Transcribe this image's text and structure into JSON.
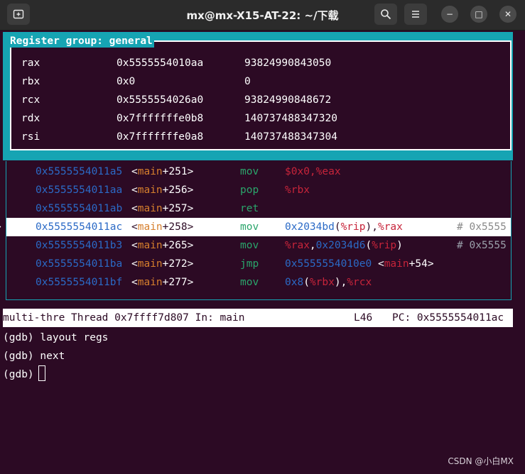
{
  "window": {
    "title": "mx@mx-X15-AT-22: ~/下载",
    "new_tab_icon": "new-tab-icon",
    "search_icon": "search-icon",
    "menu_icon": "hamburger-menu-icon",
    "minimize": "−",
    "maximize": "□",
    "close": "✕"
  },
  "registers": {
    "header": "Register group: general",
    "rows": [
      {
        "name": "rax",
        "hex": "0x5555554010aa",
        "dec": "93824990843050"
      },
      {
        "name": "rbx",
        "hex": "0x0",
        "dec": "0"
      },
      {
        "name": "rcx",
        "hex": "0x5555554026a0",
        "dec": "93824990848672"
      },
      {
        "name": "rdx",
        "hex": "0x7fffffffe0b8",
        "dec": "140737488347320"
      },
      {
        "name": "rsi",
        "hex": "0x7fffffffe0a8",
        "dec": "140737488347304"
      }
    ]
  },
  "asm": {
    "rows": [
      {
        "marker": "",
        "addr": "0x5555554011a5",
        "open": "<",
        "func": "main",
        "offset": "+251",
        "close": ">",
        "mnemonic": "mov",
        "operands": [
          {
            "t": "$0x0",
            "c": "reg"
          },
          {
            "t": ",",
            "c": "reg"
          },
          {
            "t": "%eax",
            "c": "reg"
          }
        ],
        "comment": ""
      },
      {
        "marker": "",
        "addr": "0x5555554011aa",
        "open": "<",
        "func": "main",
        "offset": "+256",
        "close": ">",
        "mnemonic": "pop",
        "operands": [
          {
            "t": "%rbx",
            "c": "reg"
          }
        ],
        "comment": ""
      },
      {
        "marker": "",
        "addr": "0x5555554011ab",
        "open": "<",
        "func": "main",
        "offset": "+257",
        "close": ">",
        "mnemonic": "ret",
        "operands": [],
        "comment": ""
      },
      {
        "marker": ">",
        "addr": "0x5555554011ac",
        "open": "<",
        "func": "main",
        "offset": "+258",
        "close": ">",
        "mnemonic": "mov",
        "operands": [
          {
            "t": "0x2034bd",
            "c": "num"
          },
          {
            "t": "(",
            "c": "paren"
          },
          {
            "t": "%rip",
            "c": "reg"
          },
          {
            "t": "),",
            "c": "paren"
          },
          {
            "t": "%rax",
            "c": "reg"
          }
        ],
        "comment": "# 0x5555"
      },
      {
        "marker": "",
        "addr": "0x5555554011b3",
        "open": "<",
        "func": "main",
        "offset": "+265",
        "close": ">",
        "mnemonic": "mov",
        "operands": [
          {
            "t": "%rax",
            "c": "reg"
          },
          {
            "t": ",",
            "c": "paren"
          },
          {
            "t": "0x2034d6",
            "c": "num"
          },
          {
            "t": "(",
            "c": "paren"
          },
          {
            "t": "%rip",
            "c": "reg"
          },
          {
            "t": ")",
            "c": "paren"
          }
        ],
        "comment": "# 0x5555"
      },
      {
        "marker": "",
        "addr": "0x5555554011ba",
        "open": "<",
        "func": "main",
        "offset": "+272",
        "close": ">",
        "mnemonic": "jmp",
        "operands": [
          {
            "t": "0x5555554010e0",
            "c": "num"
          },
          {
            "t": " <",
            "c": "paren"
          },
          {
            "t": "main",
            "c": "reg"
          },
          {
            "t": "+54",
            "c": "paren"
          },
          {
            "t": ">",
            "c": "paren"
          }
        ],
        "comment": ""
      },
      {
        "marker": "",
        "addr": "0x5555554011bf",
        "open": "<",
        "func": "main",
        "offset": "+277",
        "close": ">",
        "mnemonic": "mov",
        "operands": [
          {
            "t": "0x8",
            "c": "num"
          },
          {
            "t": "(",
            "c": "paren"
          },
          {
            "t": "%rbx",
            "c": "reg"
          },
          {
            "t": "),",
            "c": "paren"
          },
          {
            "t": "%rcx",
            "c": "reg"
          }
        ],
        "comment": ""
      }
    ]
  },
  "status": {
    "left": "multi-thre Thread 0x7ffff7d807 In: main",
    "line": "L46",
    "pc": "PC: 0x5555554011ac"
  },
  "console": {
    "lines": [
      "(gdb) layout regs",
      "(gdb) next",
      "(gdb) "
    ]
  },
  "watermark": "CSDN @小白MX"
}
